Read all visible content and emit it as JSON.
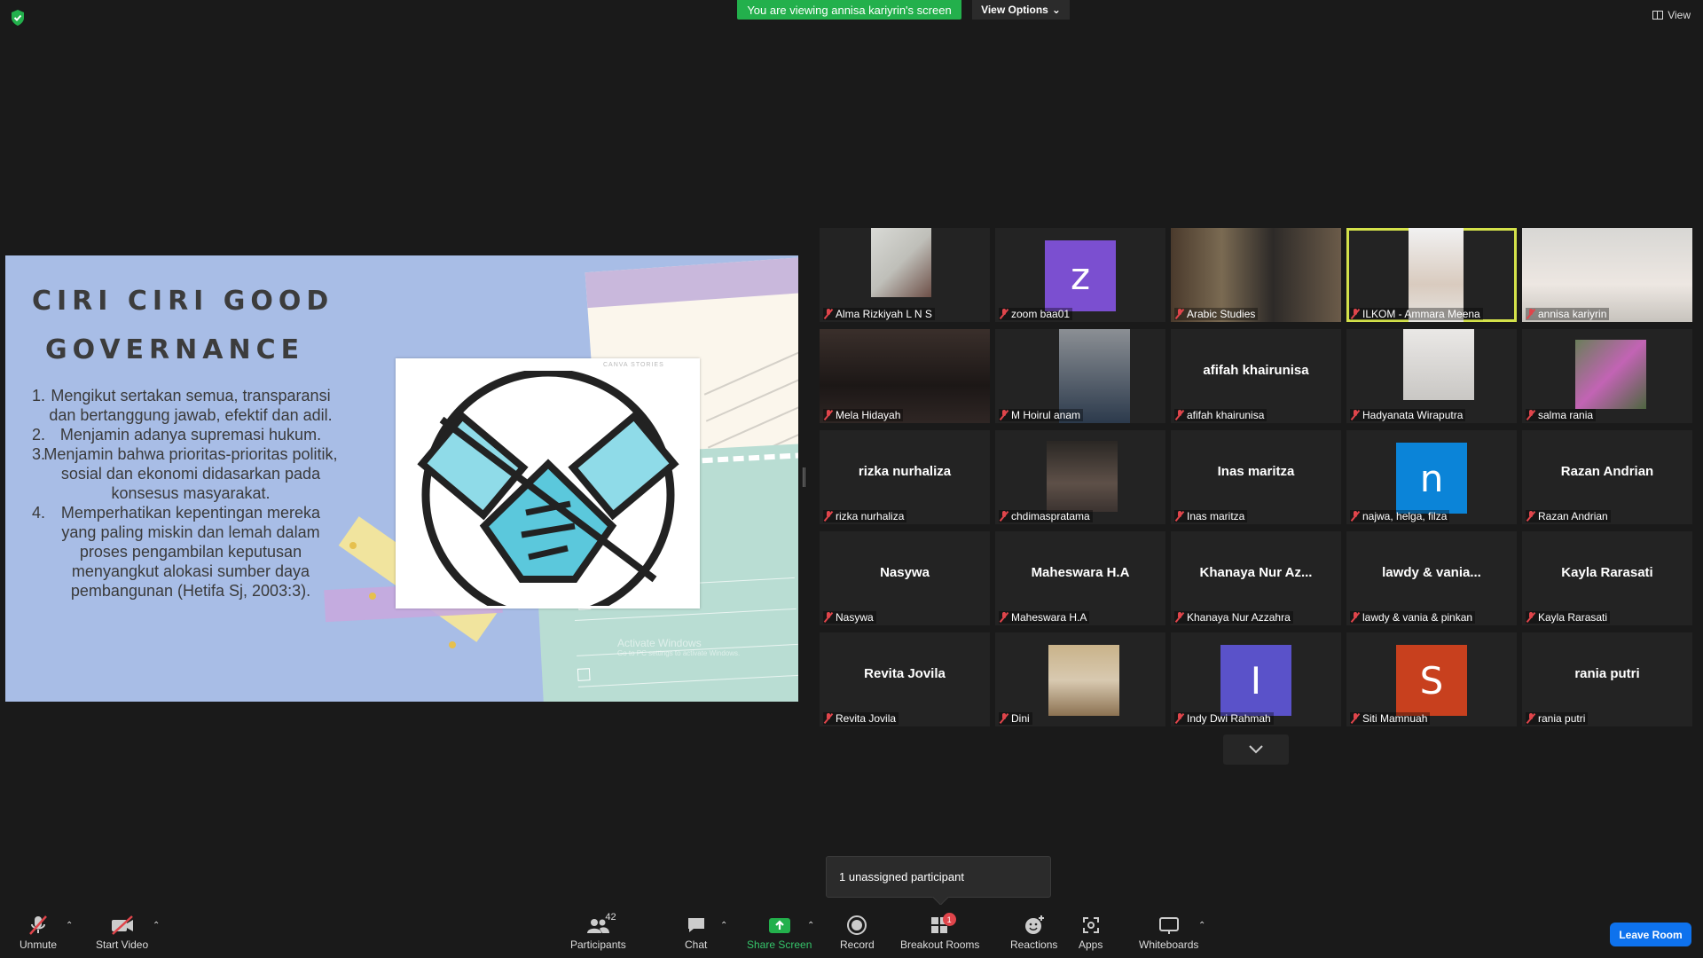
{
  "banner": {
    "viewing_text": "You are viewing annisa kariyrin's screen",
    "view_options": "View Options",
    "view_label": "View"
  },
  "colors": {
    "banner_green": "#23b04c",
    "active_speaker": "#d4e24a",
    "leave_blue": "#0e72ed",
    "muted_red": "#e0454b"
  },
  "slide": {
    "title_line1": "CIRI CIRI GOOD",
    "title_line2": "GOVERNANCE",
    "items": [
      {
        "num": "1.",
        "text": "Mengikut sertakan semua, transparansi dan bertanggung jawab, efektif dan adil."
      },
      {
        "num": "2.",
        "text": "Menjamin adanya supremasi hukum."
      },
      {
        "num": "3.",
        "text": "Menjamin bahwa prioritas-prioritas politik, sosial dan ekonomi didasarkan pada konsesus masyarakat."
      },
      {
        "num": "4.",
        "text": "Memperhatikan kepentingan mereka yang paling miskin dan lemah dalam proses pengambilan keputusan menyangkut alokasi sumber daya pembangunan (Hetifa Sj, 2003:3)."
      }
    ],
    "photo_tag": "CANVA STORIES",
    "watermark_title": "Activate Windows",
    "watermark_sub": "Go to PC settings to activate Windows."
  },
  "participants": [
    {
      "name": "Alma Rizkiyah L N S",
      "center": "",
      "type": "video",
      "avatar_letter": "",
      "avatar_color": ""
    },
    {
      "name": "zoom baa01",
      "center": "",
      "type": "avatar",
      "avatar_letter": "z",
      "avatar_color": "#7b4fd0"
    },
    {
      "name": "Arabic Studies",
      "center": "",
      "type": "video",
      "avatar_letter": "",
      "avatar_color": ""
    },
    {
      "name": "ILKOM - Ammara Meena",
      "center": "",
      "type": "video",
      "avatar_letter": "",
      "avatar_color": ""
    },
    {
      "name": "annisa kariyrin",
      "center": "",
      "type": "video",
      "avatar_letter": "",
      "avatar_color": ""
    },
    {
      "name": "Mela Hidayah",
      "center": "",
      "type": "video",
      "avatar_letter": "",
      "avatar_color": ""
    },
    {
      "name": "M Hoirul anam",
      "center": "",
      "type": "video",
      "avatar_letter": "",
      "avatar_color": ""
    },
    {
      "name": "afifah khairunisa",
      "center": "afifah khairunisa",
      "type": "name",
      "avatar_letter": "",
      "avatar_color": ""
    },
    {
      "name": "Hadyanata Wiraputra",
      "center": "",
      "type": "video",
      "avatar_letter": "",
      "avatar_color": ""
    },
    {
      "name": "salma rania",
      "center": "",
      "type": "video",
      "avatar_letter": "",
      "avatar_color": ""
    },
    {
      "name": "rizka nurhaliza",
      "center": "rizka nurhaliza",
      "type": "name",
      "avatar_letter": "",
      "avatar_color": ""
    },
    {
      "name": "chdimaspratama",
      "center": "",
      "type": "video",
      "avatar_letter": "",
      "avatar_color": ""
    },
    {
      "name": "Inas maritza",
      "center": "Inas maritza",
      "type": "name",
      "avatar_letter": "",
      "avatar_color": ""
    },
    {
      "name": "najwa, helga, filza",
      "center": "",
      "type": "avatar",
      "avatar_letter": "n",
      "avatar_color": "#0b84d8"
    },
    {
      "name": "Razan Andrian",
      "center": "Razan Andrian",
      "type": "name",
      "avatar_letter": "",
      "avatar_color": ""
    },
    {
      "name": "Nasywa",
      "center": "Nasywa",
      "type": "name",
      "avatar_letter": "",
      "avatar_color": ""
    },
    {
      "name": "Maheswara H.A",
      "center": "Maheswara H.A",
      "type": "name",
      "avatar_letter": "",
      "avatar_color": ""
    },
    {
      "name": "Khanaya Nur Azzahra",
      "center": "Khanaya Nur Az...",
      "type": "name",
      "avatar_letter": "",
      "avatar_color": ""
    },
    {
      "name": "lawdy & vania & pinkan",
      "center": "lawdy & vania...",
      "type": "name",
      "avatar_letter": "",
      "avatar_color": ""
    },
    {
      "name": "Kayla Rarasati",
      "center": "Kayla Rarasati",
      "type": "name",
      "avatar_letter": "",
      "avatar_color": ""
    },
    {
      "name": "Revita Jovila",
      "center": "Revita Jovila",
      "type": "name",
      "avatar_letter": "",
      "avatar_color": ""
    },
    {
      "name": "Dini",
      "center": "",
      "type": "video",
      "avatar_letter": "",
      "avatar_color": ""
    },
    {
      "name": "Indy Dwi Rahmah",
      "center": "",
      "type": "avatar",
      "avatar_letter": "I",
      "avatar_color": "#5a52c9"
    },
    {
      "name": "Siti Mamnuah",
      "center": "",
      "type": "avatar",
      "avatar_letter": "S",
      "avatar_color": "#c8401e"
    },
    {
      "name": "rania putri",
      "center": "rania putri",
      "type": "name",
      "avatar_letter": "",
      "avatar_color": ""
    }
  ],
  "tooltip": {
    "text": "1 unassigned participant"
  },
  "toolbar": {
    "unmute": "Unmute",
    "start_video": "Start Video",
    "participants": "Participants",
    "participants_count": "42",
    "chat": "Chat",
    "share_screen": "Share Screen",
    "record": "Record",
    "breakout_rooms": "Breakout Rooms",
    "breakout_badge": "1",
    "reactions": "Reactions",
    "apps": "Apps",
    "whiteboards": "Whiteboards",
    "leave": "Leave Room"
  }
}
